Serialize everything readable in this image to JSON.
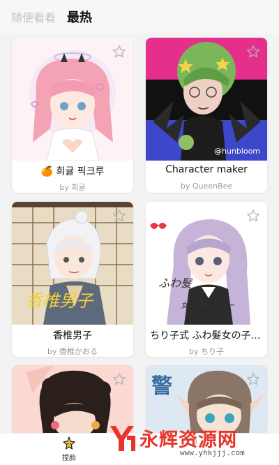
{
  "tabs": [
    {
      "label": "随便看看",
      "active": false
    },
    {
      "label": "最热",
      "active": true
    }
  ],
  "cards": [
    {
      "title": "🍊 희귤 픽크루",
      "author": "by 희귤"
    },
    {
      "title": "Character maker",
      "author": "by QueenBee"
    },
    {
      "title": "香椎男子",
      "author": "by 香椎かおる"
    },
    {
      "title": "ちり子式 ふわ髮女の子メーカー",
      "author": "by ちり子"
    },
    {
      "title": "",
      "author": ""
    },
    {
      "title": "",
      "author": ""
    }
  ],
  "artwork_text": {
    "card2_handle": "@hunbloom",
    "card3_calligraphy": "香椎男子",
    "card4_calligraphy_1": "ふわ髮",
    "card4_calligraphy_2": "女の子メーカー",
    "card6_sign": "警"
  },
  "bottom_nav": [
    {
      "label": "捏脸",
      "icon": "sparkle-face-icon"
    },
    {
      "label": "",
      "icon": "nav-icon"
    }
  ],
  "watermark": {
    "text": "永辉资源网",
    "url": "www.yhkjjj.com"
  },
  "colors": {
    "accent_red": "#e8352b",
    "pink_hair": "#f4a3b5",
    "purple_hair": "#c6b4d8"
  }
}
